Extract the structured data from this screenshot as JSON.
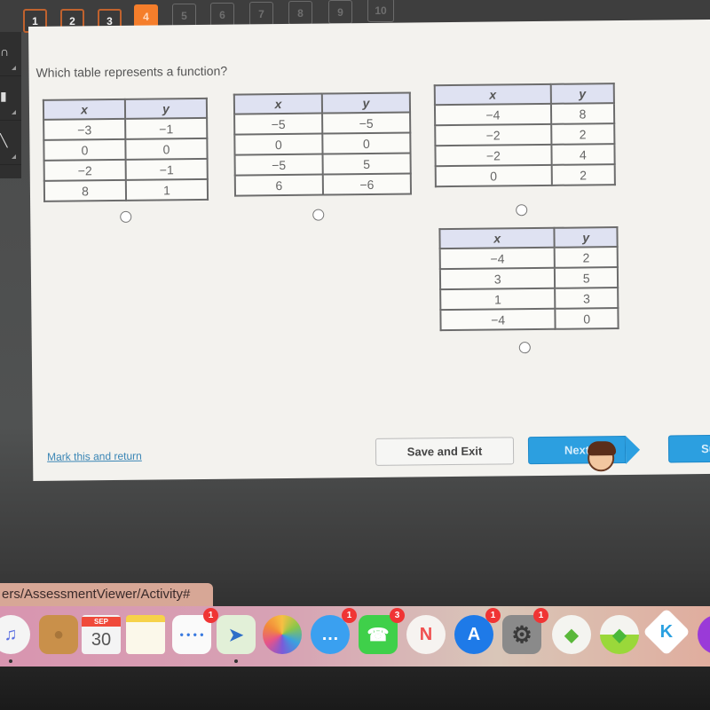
{
  "nav": {
    "questions": [
      {
        "label": "1",
        "state": "done"
      },
      {
        "label": "2",
        "state": "done"
      },
      {
        "label": "3",
        "state": "done"
      },
      {
        "label": "4",
        "state": "current"
      },
      {
        "label": "5",
        "state": "future"
      },
      {
        "label": "6",
        "state": "future"
      },
      {
        "label": "7",
        "state": "future"
      },
      {
        "label": "8",
        "state": "future"
      },
      {
        "label": "9",
        "state": "future"
      },
      {
        "label": "10",
        "state": "future"
      }
    ],
    "accent_color": "#f57e2b"
  },
  "left_tools": [
    "headphones-icon",
    "calculator-icon",
    "pencil-icon"
  ],
  "question": {
    "text": "Which table represents a function?",
    "header_x": "x",
    "header_y": "y",
    "options": [
      {
        "rows": [
          [
            "−3",
            "−1"
          ],
          [
            "0",
            "0"
          ],
          [
            "−2",
            "−1"
          ],
          [
            "8",
            "1"
          ]
        ],
        "selected": false
      },
      {
        "rows": [
          [
            "−5",
            "−5"
          ],
          [
            "0",
            "0"
          ],
          [
            "−5",
            "5"
          ],
          [
            "6",
            "−6"
          ]
        ],
        "selected": false
      },
      {
        "rows": [
          [
            "−4",
            "8"
          ],
          [
            "−2",
            "2"
          ],
          [
            "−2",
            "4"
          ],
          [
            "0",
            "2"
          ]
        ],
        "selected": false
      },
      {
        "rows": [
          [
            "−4",
            "2"
          ],
          [
            "3",
            "5"
          ],
          [
            "1",
            "3"
          ],
          [
            "−4",
            "0"
          ]
        ],
        "selected": false
      }
    ]
  },
  "footer": {
    "mark_link": "Mark this and return",
    "save_exit": "Save and Exit",
    "next": "Next",
    "submit": "Su"
  },
  "browser": {
    "url_fragment": "ers/AssessmentViewer/Activity#"
  },
  "dock": {
    "items": [
      {
        "name": "music",
        "badge": null,
        "running": true
      },
      {
        "name": "contacts",
        "badge": null,
        "running": false
      },
      {
        "name": "calendar",
        "month": "SEP",
        "day": "30",
        "badge": null,
        "running": false
      },
      {
        "name": "notes",
        "badge": null,
        "running": false
      },
      {
        "name": "reminders",
        "badge": "1",
        "running": false
      },
      {
        "name": "maps",
        "badge": null,
        "running": true
      },
      {
        "name": "photos",
        "badge": null,
        "running": false
      },
      {
        "name": "messages",
        "badge": "1",
        "running": false
      },
      {
        "name": "facetime",
        "badge": "3",
        "running": false
      },
      {
        "name": "news",
        "badge": null,
        "running": false
      },
      {
        "name": "app-store",
        "badge": "1",
        "running": false
      },
      {
        "name": "system-preferences",
        "badge": "1",
        "running": false
      },
      {
        "name": "the-sims",
        "badge": null,
        "running": false
      },
      {
        "name": "sims-launcher",
        "badge": null,
        "running": false
      },
      {
        "name": "kodi",
        "badge": null,
        "running": false
      }
    ]
  }
}
